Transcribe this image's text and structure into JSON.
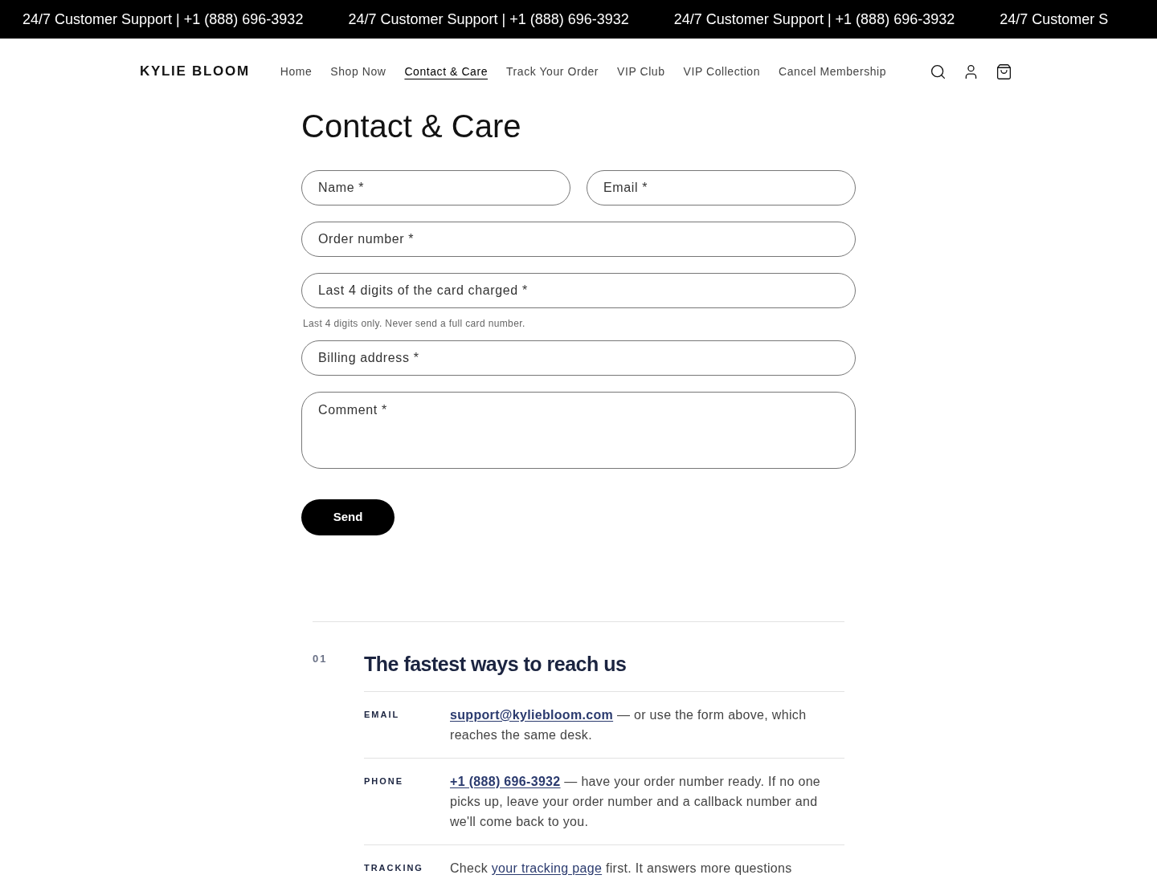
{
  "announcement_bar": [
    "24/7 Customer Support | +1 (888) 696-3932",
    "24/7 Customer Support | +1 (888) 696-3932",
    "24/7 Customer Support | +1 (888) 696-3932",
    "24/7 Customer S"
  ],
  "header": {
    "logo": "KYLIE BLOOM",
    "nav": [
      {
        "label": "Home",
        "selected": false
      },
      {
        "label": "Shop Now",
        "selected": false
      },
      {
        "label": "Contact & Care",
        "selected": true
      },
      {
        "label": "Track Your Order",
        "selected": false
      },
      {
        "label": "VIP Club",
        "selected": false
      },
      {
        "label": "VIP Collection",
        "selected": false
      },
      {
        "label": "Cancel Membership",
        "selected": false
      }
    ]
  },
  "page_title": "Contact & Care",
  "form": {
    "rows": [
      [
        {
          "kind": "input",
          "placeholder": "Name *"
        },
        {
          "kind": "input",
          "placeholder": "Email *"
        }
      ],
      [
        {
          "kind": "input",
          "placeholder": "Order number *"
        }
      ],
      [
        {
          "kind": "input",
          "placeholder": "Last 4 digits of the card charged *",
          "hint": "Last 4 digits only. Never send a full card number."
        }
      ],
      [
        {
          "kind": "input",
          "placeholder": "Billing address *"
        }
      ],
      [
        {
          "kind": "textarea",
          "placeholder": "Comment *"
        }
      ]
    ],
    "submit": "Send"
  },
  "section": {
    "number": "01",
    "title": "The fastest ways to reach us",
    "rows": [
      {
        "label": "EMAIL",
        "link_bold": true,
        "before": "",
        "link": "support@kyliebloom.com",
        "after": " — or use the form above, which reaches the same desk."
      },
      {
        "label": "PHONE",
        "link_bold": true,
        "before": "",
        "link": "+1 (888) 696-3932",
        "after": " — have your order number ready. If no one picks up, leave your order number and a callback number and we'll come back to you."
      },
      {
        "label": "TRACKING",
        "link_bold": false,
        "before": "Check ",
        "link": "your tracking page",
        "after": " first. It answers more questions"
      }
    ]
  }
}
